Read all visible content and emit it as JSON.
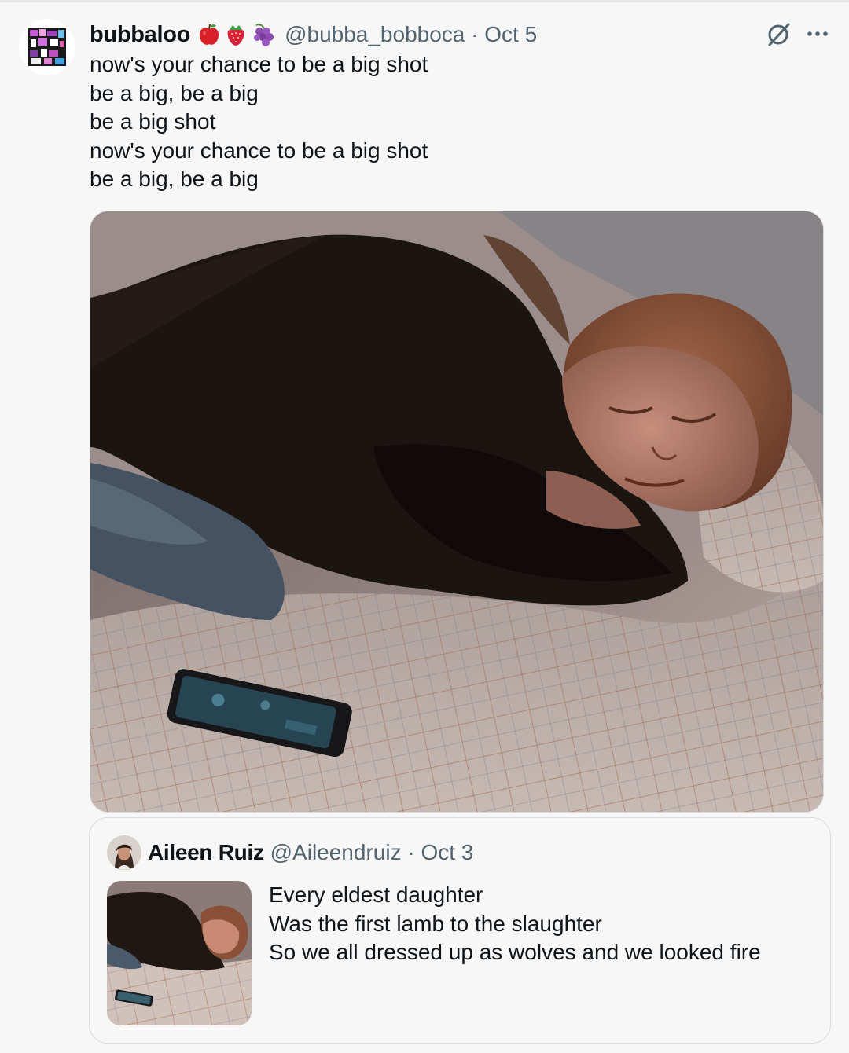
{
  "post": {
    "display_name": "bubbaloo",
    "emoji_icons": [
      "red-apple-icon",
      "strawberry-icon",
      "grapes-icon"
    ],
    "handle": "@bubba_bobboca",
    "separator": "·",
    "date": "Oct 5",
    "lines": [
      "now's your chance to be a big shot",
      "be a big, be a big",
      "be a big shot",
      "now's your chance to be a big shot",
      "be a big, be a big"
    ]
  },
  "quote": {
    "display_name": "Aileen Ruiz",
    "handle": "@Aileendruiz",
    "separator": "·",
    "date": "Oct 3",
    "lines": [
      "Every eldest daughter",
      "Was the first lamb to the slaughter",
      "So we all dressed up as wolves and we looked fire"
    ]
  },
  "colors": {
    "background": "#f7f7f7",
    "text": "#0f1419",
    "secondary_text": "#536471"
  }
}
